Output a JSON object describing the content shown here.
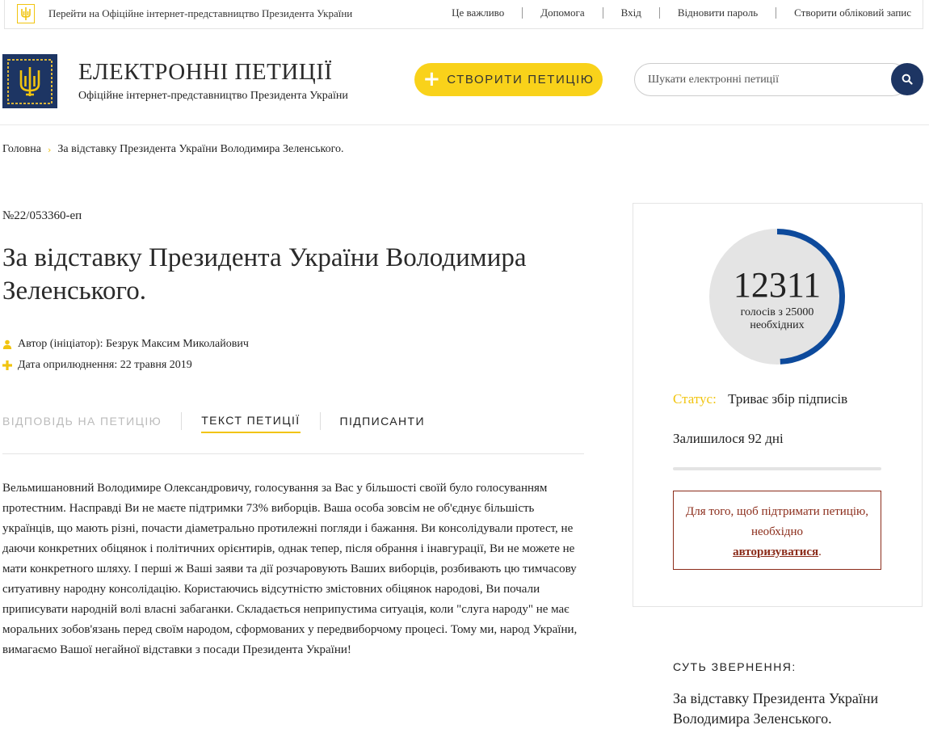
{
  "topbar": {
    "official_link": "Перейти на Офіційне інтернет-представництво Президента України",
    "nav": [
      "Це важливо",
      "Допомога",
      "Вхід",
      "Відновити пароль",
      "Створити обліковий запис"
    ]
  },
  "header": {
    "title": "ЕЛЕКТРОННІ ПЕТИЦІЇ",
    "subtitle": "Офіційне інтернет-представництво Президента України",
    "create_button": "СТВОРИТИ ПЕТИЦІЮ",
    "search_placeholder": "Шукати електронні петиції"
  },
  "breadcrumb": {
    "home": "Головна",
    "current": "За відставку Президента України Володимира Зеленського."
  },
  "petition": {
    "number": "№22/053360-еп",
    "title": "За відставку Президента України Володимира Зеленського.",
    "author_label": "Автор (ініціатор): Безрук Максим Миколайович",
    "date_label": "Дата оприлюднення: 22 травня 2019",
    "tabs": [
      "ВІДПОВІДЬ НА ПЕТИЦІЮ",
      "ТЕКСТ ПЕТИЦІЇ",
      "ПІДПИСАНТИ"
    ],
    "body": "Вельмишановний Володимире Олександровичу, голосування за Вас у більшості своїй було голосуванням протестним. Насправді Ви не маєте підтримки 73% виборців. Ваша особа зовсім не об'єднує більшість українців, що мають різні, почасти діаметрально протилежні погляди і бажання. Ви консолідували протест, не даючи конкретних обіцянок і політичних орієнтирів, однак тепер, після обрання і інавгурації, Ви не можете не мати конкретного шляху. І перші ж Ваші заяви та дії розчаровують Ваших виборців, розбивають цю тимчасову ситуативну народну консолідацію. Користаючись відсутністю змістовних обіцянок народові, Ви почали приписувати народній волі власні забаганки. Складається неприпустима ситуація, коли \"слуга народу\" не має моральних зобов'язань перед своїм народом, сформованих у передвиборчому процесі. Тому ми, народ України, вимагаємо Вашої негайної відставки з посади Президента України!"
  },
  "votes": {
    "count": "12311",
    "caption": "голосів з 25000 необхідних",
    "collected": 12311,
    "required": 25000
  },
  "status": {
    "label": "Статус:",
    "value": "Триває збір підписів",
    "remaining": "Залишилося 92 дні"
  },
  "auth_notice": {
    "text_before": "Для того, щоб підтримати петицію, необхідно",
    "link": "авторизуватися",
    "text_after": "."
  },
  "essence": {
    "label": "СУТЬ ЗВЕРНЕННЯ:",
    "text": "За відставку Президента України Володимира Зеленського."
  },
  "colors": {
    "accent_yellow": "#f9d21a",
    "navy": "#1d3563",
    "progress_blue": "#0d4a9c",
    "alert_red": "#8b2c1a"
  }
}
